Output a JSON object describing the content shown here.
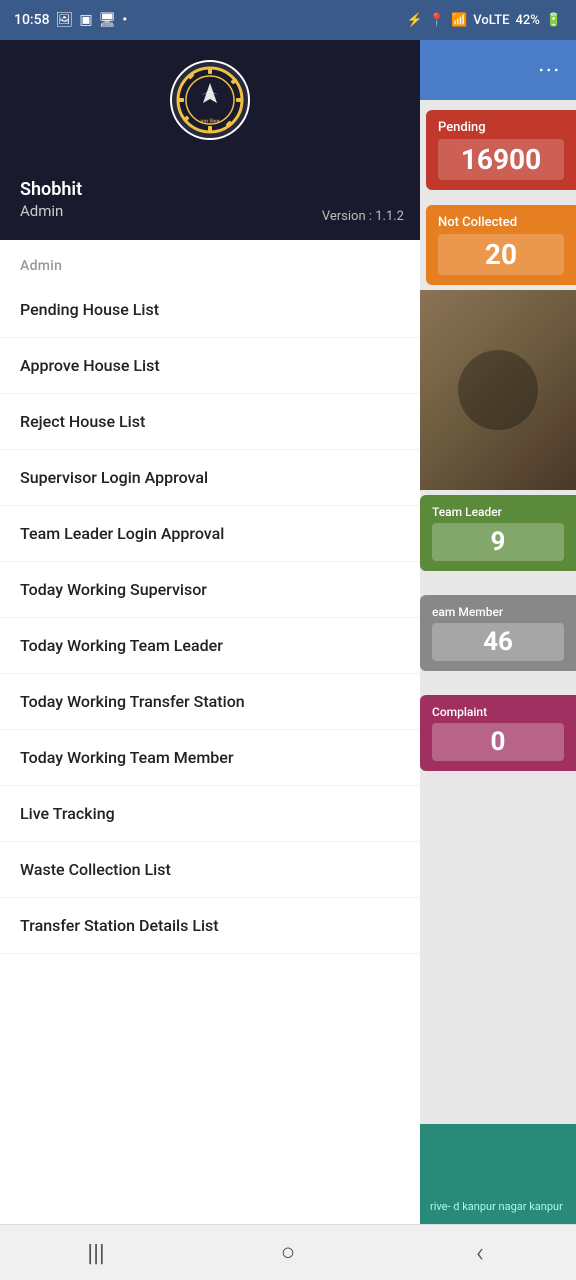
{
  "status_bar": {
    "time": "10:58",
    "battery": "42%",
    "signal": "VoLTE"
  },
  "drawer": {
    "user_name": "Shobhit",
    "user_role": "Admin",
    "version": "Version : 1.1.2",
    "section_label": "Admin",
    "menu_items": [
      {
        "id": "pending-house-list",
        "label": "Pending House List"
      },
      {
        "id": "approve-house-list",
        "label": "Approve House List"
      },
      {
        "id": "reject-house-list",
        "label": "Reject House List"
      },
      {
        "id": "supervisor-login-approval",
        "label": "Supervisor Login Approval"
      },
      {
        "id": "team-leader-login-approval",
        "label": "Team Leader Login Approval"
      },
      {
        "id": "today-working-supervisor",
        "label": "Today Working Supervisor"
      },
      {
        "id": "today-working-team-leader",
        "label": "Today Working Team Leader"
      },
      {
        "id": "today-working-transfer-station",
        "label": "Today Working Transfer Station"
      },
      {
        "id": "today-working-team-member",
        "label": "Today Working Team Member"
      },
      {
        "id": "live-tracking",
        "label": "Live Tracking"
      },
      {
        "id": "waste-collection-list",
        "label": "Waste Collection List"
      },
      {
        "id": "transfer-station-details-list",
        "label": "Transfer Station Details List"
      }
    ]
  },
  "cards": {
    "pending": {
      "label": "Pending",
      "value": "16900"
    },
    "not_collected": {
      "label": "Not Collected",
      "value": "20"
    },
    "team_leader": {
      "label": "Team Leader",
      "value": "9"
    },
    "team_member": {
      "label": "eam Member",
      "value": "46"
    },
    "complaint": {
      "label": "Complaint",
      "value": "0"
    },
    "banner": {
      "text": "rive-\nd kanpur nagar\nkanpur"
    }
  },
  "nav": {
    "menu_icon": "|||",
    "home_icon": "○",
    "back_icon": "‹"
  },
  "three_dots_menu": "⋮"
}
